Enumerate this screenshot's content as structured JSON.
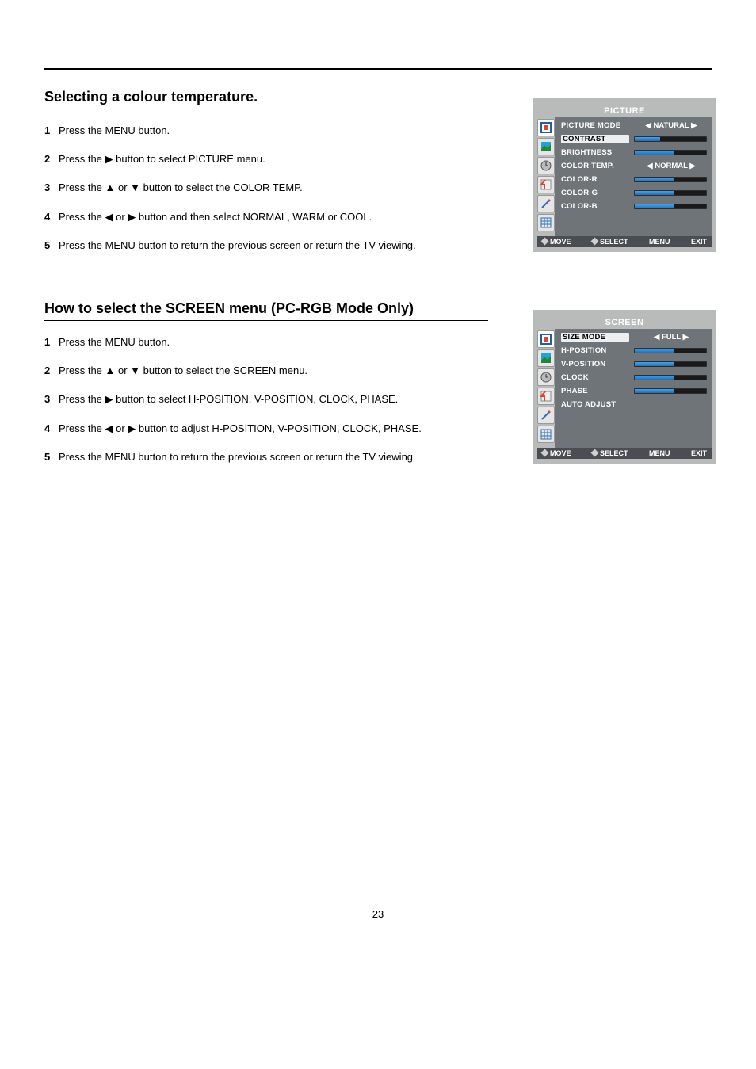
{
  "page_number": "23",
  "sections": [
    {
      "title": "Selecting a colour temperature.",
      "steps": [
        "Press the MENU button.",
        "Press the ▶ button to select PICTURE menu.",
        "Press the ▲ or ▼ button to select the COLOR TEMP.",
        "Press the ◀ or ▶ button and then select NORMAL, WARM or COOL.",
        "Press the MENU button to return the previous screen or return the TV viewing."
      ],
      "osd": {
        "title": "PICTURE",
        "rows": [
          {
            "name": "PICTURE MODE",
            "type": "enum",
            "value": "NATURAL"
          },
          {
            "name": "CONTRAST",
            "type": "slider",
            "fill": 35,
            "selected": true
          },
          {
            "name": "BRIGHTNESS",
            "type": "slider",
            "fill": 55
          },
          {
            "name": "COLOR TEMP.",
            "type": "enum",
            "value": "NORMAL"
          },
          {
            "name": "COLOR-R",
            "type": "slider",
            "fill": 55
          },
          {
            "name": "COLOR-G",
            "type": "slider",
            "fill": 55
          },
          {
            "name": "COLOR-B",
            "type": "slider",
            "fill": 55
          }
        ],
        "footer": {
          "move": "MOVE",
          "select": "SELECT",
          "menu": "MENU",
          "exit": "EXIT"
        }
      }
    },
    {
      "title": "How to select the SCREEN menu (PC-RGB Mode Only)",
      "steps": [
        "Press the MENU button.",
        "Press the ▲ or ▼ button to select the SCREEN menu.",
        "Press the ▶ button to select H-POSITION, V-POSITION, CLOCK, PHASE.",
        "Press the ◀ or ▶ button to adjust H-POSITION, V-POSITION, CLOCK, PHASE.",
        "Press the MENU button to return the previous screen or return the TV viewing."
      ],
      "osd": {
        "title": "SCREEN",
        "rows": [
          {
            "name": "SIZE MODE",
            "type": "enum",
            "value": "FULL",
            "selected": true
          },
          {
            "name": "H-POSITION",
            "type": "slider",
            "fill": 55
          },
          {
            "name": "V-POSITION",
            "type": "slider",
            "fill": 55
          },
          {
            "name": "CLOCK",
            "type": "slider",
            "fill": 55
          },
          {
            "name": "PHASE",
            "type": "slider",
            "fill": 55
          },
          {
            "name": "AUTO ADJUST",
            "type": "label"
          }
        ],
        "footer": {
          "move": "MOVE",
          "select": "SELECT",
          "menu": "MENU",
          "exit": "EXIT"
        }
      }
    }
  ],
  "icons": {
    "tab1": "picture-icon",
    "tab2": "image-icon",
    "tab3": "clock-icon",
    "tab4": "list-icon",
    "tab5": "tools-icon",
    "tab6": "grid-icon"
  }
}
